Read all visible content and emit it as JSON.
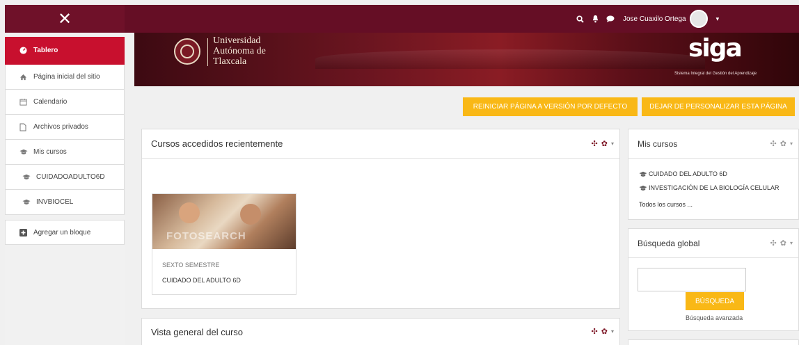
{
  "topbar": {
    "close_label": "✕",
    "user_name": "Jose Cuaxilo Ortega",
    "caret": "▾"
  },
  "sidebar": {
    "items": [
      {
        "label": "Tablero",
        "icon": "dashboard-icon"
      },
      {
        "label": "Página inicial del sitio",
        "icon": "home-icon"
      },
      {
        "label": "Calendario",
        "icon": "calendar-icon"
      },
      {
        "label": "Archivos privados",
        "icon": "file-icon"
      },
      {
        "label": "Mis cursos",
        "icon": "graduation-cap-icon"
      },
      {
        "label": "CUIDADOADULTO6D",
        "icon": "graduation-cap-icon"
      },
      {
        "label": "INVBIOCEL",
        "icon": "graduation-cap-icon"
      },
      {
        "label": "Agregar un bloque",
        "icon": "plus-square-icon"
      }
    ]
  },
  "banner": {
    "university_line1": "Universidad",
    "university_line2": "Autónoma de",
    "university_line3": "Tlaxcala",
    "siga_logo": "siga",
    "siga_subtitle": "Sistema Integral del Gestión del Aprendizaje"
  },
  "actions": {
    "reset_label": "REINICIAR PÁGINA A VERSIÓN POR DEFECTO",
    "stop_customize_label": "DEJAR DE PERSONALIZAR ESTA PÁGINA"
  },
  "recent_courses": {
    "title": "Cursos accedidos recientemente",
    "card": {
      "category": "SEXTO SEMESTRE",
      "name": "CUIDADO DEL ADULTO 6D",
      "image_watermark": "FOTOSEARCH"
    }
  },
  "course_overview": {
    "title": "Vista general del curso"
  },
  "my_courses": {
    "title": "Mis cursos",
    "courses": [
      "CUIDADO DEL ADULTO 6D",
      "INVESTIGACIÓN DE LA BIOLOGÍA CELULAR"
    ],
    "all_courses": "Todos los cursos ..."
  },
  "global_search": {
    "title": "Búsqueda global",
    "button": "BÚSQUEDA",
    "advanced": "Búsqueda avanzada"
  },
  "colors": {
    "topbar": "#650e25",
    "active": "#c8102e",
    "accent": "#f9b816"
  }
}
